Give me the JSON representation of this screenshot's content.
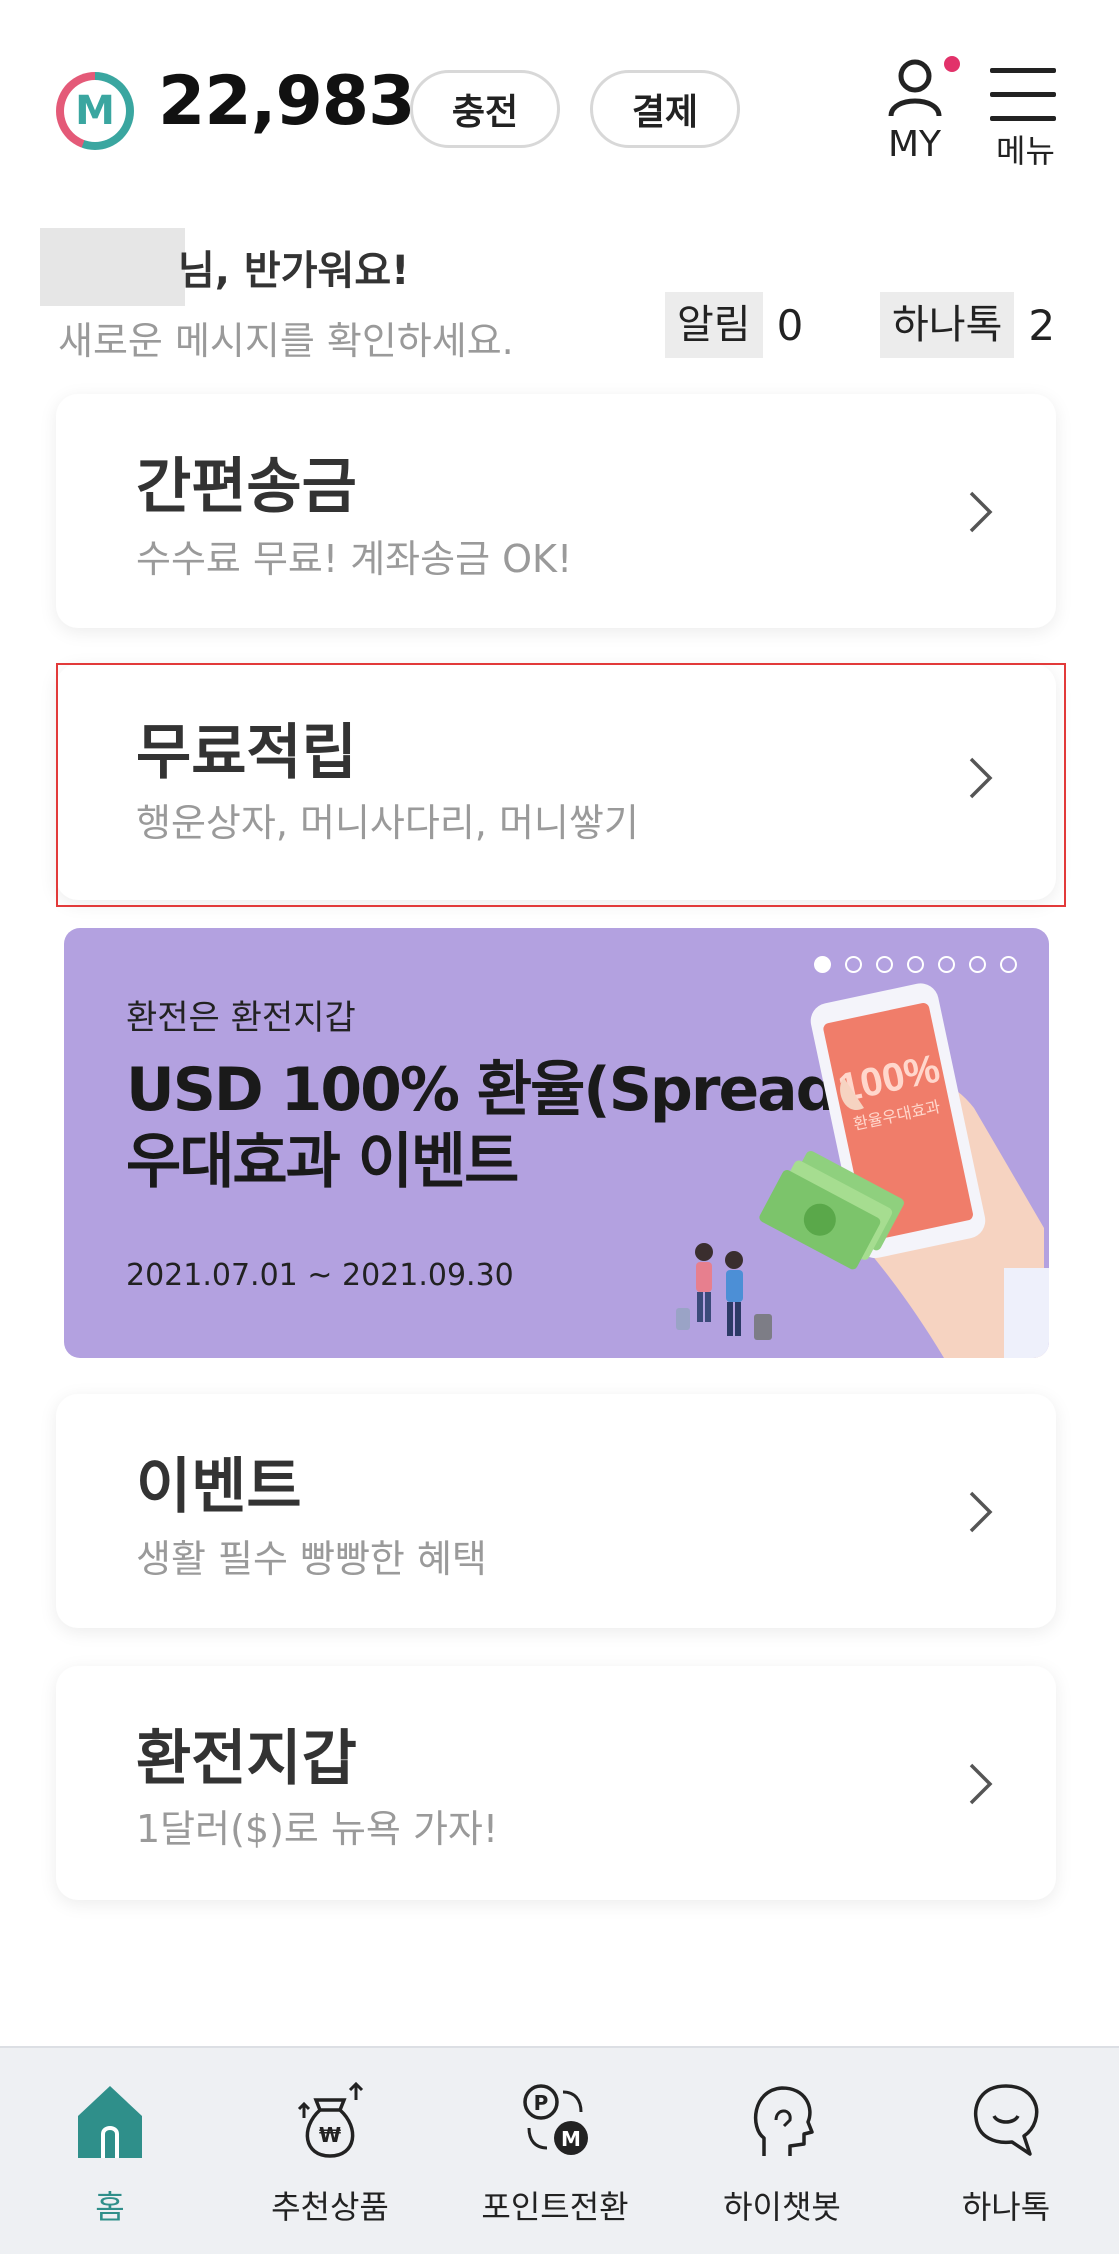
{
  "header": {
    "logo_letter": "M",
    "points": "22,983",
    "charge_label": "충전",
    "pay_label": "결제",
    "my_label": "MY",
    "menu_label": "메뉴"
  },
  "greeting": {
    "name_suffix": "님, 반가워요!",
    "message": "새로운 메시지를 확인하세요.",
    "alarm_label": "알림",
    "alarm_count": "0",
    "hanatalk_label": "하나톡",
    "hanatalk_count": "2"
  },
  "cards": [
    {
      "title": "간편송금",
      "subtitle": "수수료 무료! 계좌송금 OK!"
    },
    {
      "title": "무료적립",
      "subtitle": "행운상자, 머니사다리, 머니쌓기"
    },
    {
      "title": "이벤트",
      "subtitle": "생활 필수 빵빵한 혜택"
    },
    {
      "title": "환전지갑",
      "subtitle": "1달러($)로 뉴욕 가자!"
    }
  ],
  "banner": {
    "small_text": "환전은 환전지갑",
    "headline_line1": "USD 100% 환율(Spread)",
    "headline_line2": "우대효과 이벤트",
    "period": "2021.07.01 ~ 2021.09.30",
    "phone_text": "100%",
    "phone_subtext": "환율우대효과",
    "slide_count": 7,
    "active_slide": 1,
    "background_color": "#b3a1e0"
  },
  "tabbar": {
    "items": [
      {
        "label": "홈",
        "icon": "home-icon",
        "active": true
      },
      {
        "label": "추천상품",
        "icon": "money-bag-icon",
        "active": false
      },
      {
        "label": "포인트전환",
        "icon": "point-exchange-icon",
        "active": false
      },
      {
        "label": "하이챗봇",
        "icon": "chatbot-head-icon",
        "active": false
      },
      {
        "label": "하나톡",
        "icon": "chat-bubble-icon",
        "active": false
      }
    ]
  },
  "colors": {
    "accent_teal": "#2f8f8a",
    "notification_dot": "#e2326a",
    "highlight_border": "#e23a3a"
  }
}
